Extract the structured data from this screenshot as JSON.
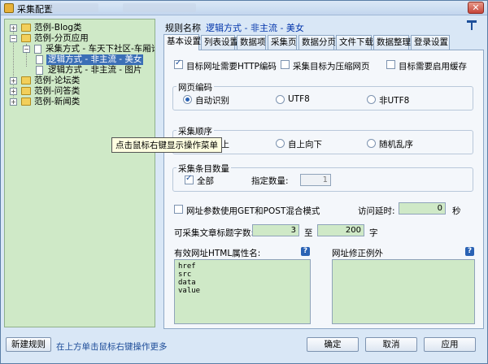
{
  "window": {
    "title": "采集配置"
  },
  "tree": {
    "nodes": [
      {
        "label": "范例-Blog类"
      },
      {
        "label": "范例-分页应用"
      },
      {
        "label": "采集方式 - 车天下社区-车厢论"
      },
      {
        "label": "逻辑方式 - 非主流 - 美女"
      },
      {
        "label": "逻辑方式 - 非主流 - 图片"
      },
      {
        "label": "范例-论坛类"
      },
      {
        "label": "范例-问答类"
      },
      {
        "label": "范例-新闻类"
      }
    ],
    "tooltip": "点击鼠标右键显示操作菜单"
  },
  "rule": {
    "label": "规则名称",
    "value": "逻辑方式 - 非主流 - 美女"
  },
  "tabs": [
    {
      "label": "基本设置"
    },
    {
      "label": "列表设置"
    },
    {
      "label": "数据项"
    },
    {
      "label": "采集页"
    },
    {
      "label": "数据分页"
    },
    {
      "label": "文件下载"
    },
    {
      "label": "数据整理"
    },
    {
      "label": "登录设置"
    }
  ],
  "basic": {
    "chk_http": "目标网址需要HTTP编码",
    "chk_compress": "采集目标为压缩网页",
    "chk_cache": "目标需要启用缓存",
    "encoding": {
      "title": "网页编码",
      "opt_auto": "自动识别",
      "opt_utf8": "UTF8",
      "opt_nonutf8": "非UTF8"
    },
    "order": {
      "title": "采集顺序",
      "opt_bottom_up": "自下向上",
      "opt_top_down": "自上向下",
      "opt_random": "随机乱序"
    },
    "count": {
      "title": "采集条目数量",
      "chk_all": "全部",
      "specify_label": "指定数量:",
      "specify_value": "1"
    },
    "mixed_mode": "网址参数使用GET和POST混合模式",
    "delay_label": "访问延时:",
    "delay_value": "0",
    "delay_unit": "秒",
    "title_len_label": "可采集文章标题字数:",
    "title_len_min": "3",
    "title_len_sep": "至",
    "title_len_max": "200",
    "title_len_unit": "字",
    "attr_label": "有效网址HTML属性名:",
    "attr_lines": "href\nsrc\ndata\nvalue",
    "exception_label": "网址修正例外"
  },
  "footer": {
    "new_rule": "新建规则",
    "hint": "在上方单击鼠标右键操作更多",
    "ok": "确定",
    "cancel": "取消",
    "apply": "应用"
  }
}
